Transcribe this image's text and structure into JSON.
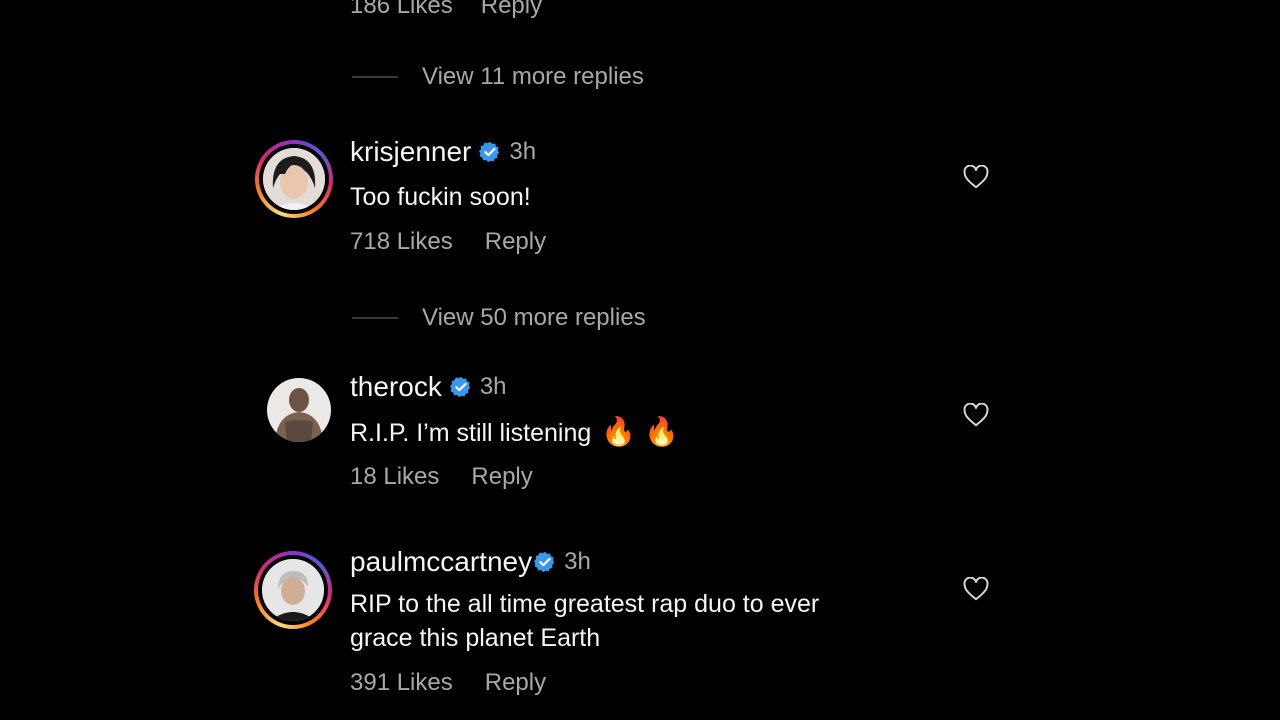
{
  "top_cut": {
    "likes": "186 Likes",
    "reply": "Reply"
  },
  "view_more_1": "View 11 more replies",
  "view_more_2": "View 50 more replies",
  "comments": [
    {
      "username": "krisjenner",
      "time": "3h",
      "text": "Too fuckin soon!",
      "likes": "718 Likes",
      "reply": "Reply"
    },
    {
      "username": "therock",
      "time": "3h",
      "text": "R.I.P. I’m still listening",
      "emoji": "🔥 🔥",
      "likes": "18 Likes",
      "reply": "Reply"
    },
    {
      "username": "paulmccartney",
      "time": "3h",
      "text_line1": "RIP to the all time greatest rap duo to ever",
      "text_line2": "grace this planet Earth",
      "likes": "391 Likes",
      "reply": "Reply"
    }
  ],
  "colors": {
    "background": "#000000",
    "text_primary": "#f5f5f5",
    "text_secondary": "#a8a8a8",
    "verified_badge": "#3897f0"
  },
  "icons": {
    "like": "heart-outline-icon",
    "verified": "verified-badge-icon"
  }
}
